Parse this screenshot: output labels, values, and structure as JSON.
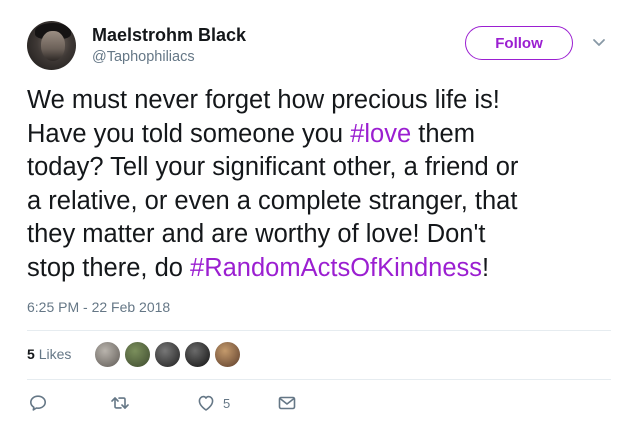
{
  "user": {
    "name": "Maelstrohm Black",
    "handle": "@Taphophiliacs"
  },
  "follow_button": {
    "label": "Follow"
  },
  "tweet": {
    "segments": [
      {
        "text": "We must never forget how precious life is!\nHave you told someone you ",
        "hashtag": false
      },
      {
        "text": "#love",
        "hashtag": true
      },
      {
        "text": " them\ntoday?  Tell your significant other, a friend or\na relative, or even a complete stranger, that\nthey matter and are worthy of love!  Don't\nstop there, do  ",
        "hashtag": false
      },
      {
        "text": "#RandomActsOfKindness",
        "hashtag": true
      },
      {
        "text": "!",
        "hashtag": false
      }
    ],
    "timestamp": "6:25 PM - 22 Feb 2018"
  },
  "stats": {
    "likes_count": "5",
    "likes_label": "Likes",
    "liker_avatars": [
      {
        "color_a": "#b9b4ad",
        "color_b": "#5f5a55"
      },
      {
        "color_a": "#7b8f5c",
        "color_b": "#3d4a2e"
      },
      {
        "color_a": "#777777",
        "color_b": "#1f1f1f"
      },
      {
        "color_a": "#6a6a6a",
        "color_b": "#111111"
      },
      {
        "color_a": "#c49a6c",
        "color_b": "#5b3c2a"
      }
    ]
  },
  "actions": {
    "reply_icon": "reply-icon",
    "retweet_icon": "retweet-icon",
    "like_icon": "heart-icon",
    "like_count": "5",
    "message_icon": "envelope-icon"
  },
  "colors": {
    "accent": "#9b1fd1",
    "text": "#14171a",
    "muted": "#657786",
    "divider": "#e6ecf0"
  }
}
